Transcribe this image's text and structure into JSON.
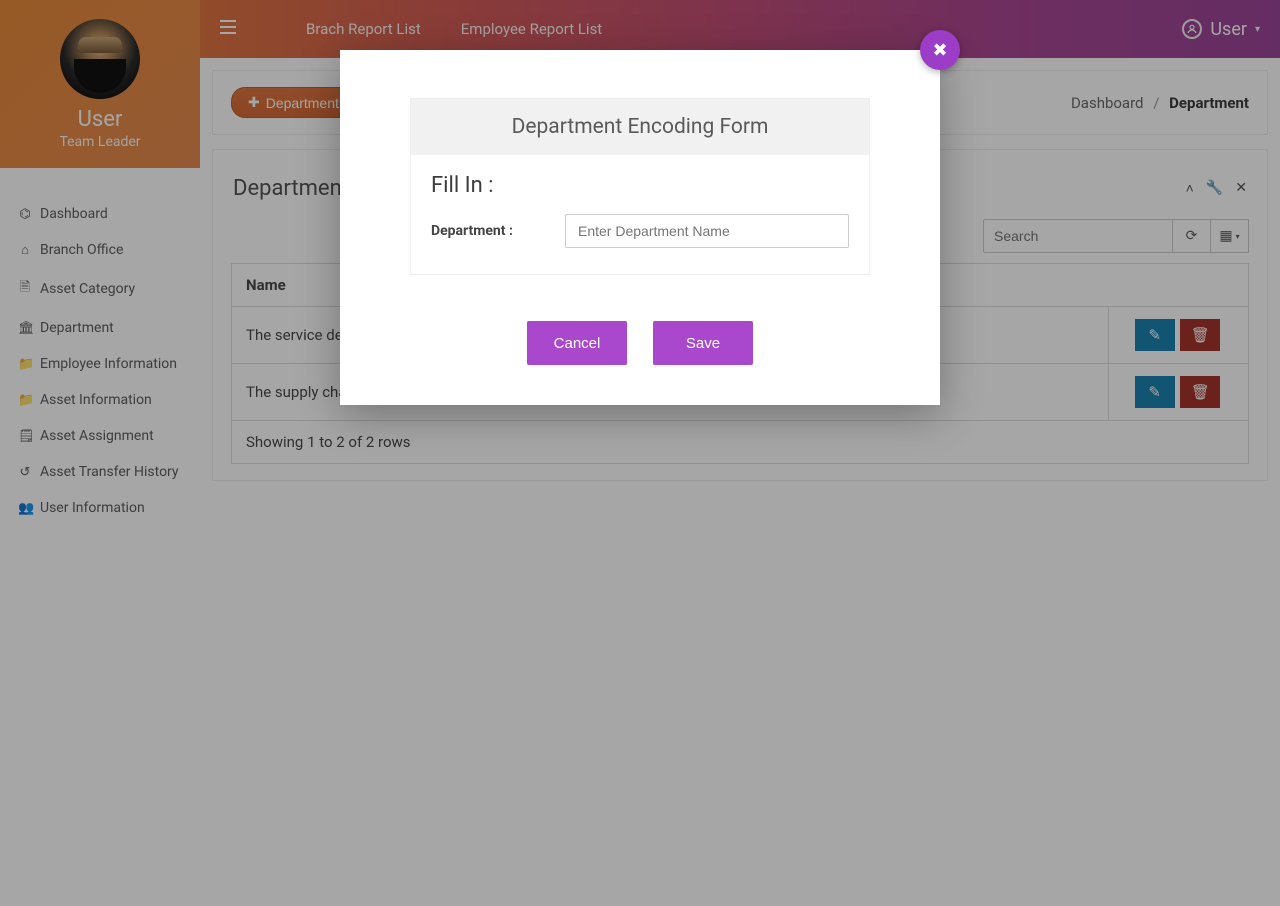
{
  "user": {
    "name": "User",
    "role": "Team Leader"
  },
  "topnav": {
    "links": [
      "Brach Report List",
      "Employee Report List"
    ],
    "user_label": "User"
  },
  "sidebar": {
    "items": [
      {
        "icon": "⌬",
        "label": "Dashboard"
      },
      {
        "icon": "⌂",
        "label": "Branch Office"
      },
      {
        "icon": "🗎",
        "label": "Asset Category"
      },
      {
        "icon": "🏛",
        "label": "Department"
      },
      {
        "icon": "📁",
        "label": "Employee Information"
      },
      {
        "icon": "📁",
        "label": "Asset Information"
      },
      {
        "icon": "🗒",
        "label": "Asset Assignment"
      },
      {
        "icon": "↺",
        "label": "Asset Transfer History"
      },
      {
        "icon": "👥",
        "label": "User Information"
      }
    ]
  },
  "page": {
    "add_button_label": "Department",
    "breadcrumb": {
      "root": "Dashboard",
      "current": "Department"
    }
  },
  "table": {
    "title": "Department List",
    "search_placeholder": "Search",
    "columns": [
      "Name"
    ],
    "rows": [
      {
        "name": "The service department"
      },
      {
        "name": "The supply chain unit"
      }
    ],
    "footer": "Showing 1 to 2 of 2 rows"
  },
  "modal": {
    "title": "Department Encoding Form",
    "subtitle": "Fill In :",
    "field_label": "Department :",
    "input_placeholder": "Enter Department Name",
    "cancel_label": "Cancel",
    "save_label": "Save"
  }
}
